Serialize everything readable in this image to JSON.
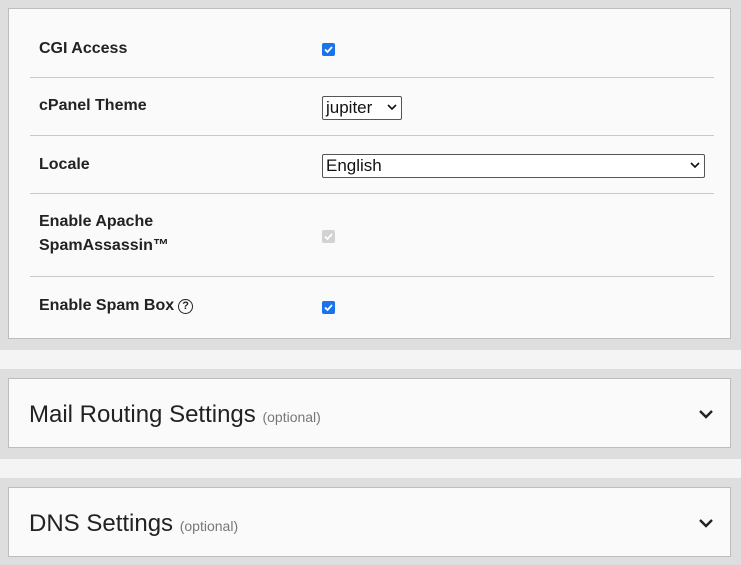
{
  "settings": {
    "cgi_access": {
      "label": "CGI Access",
      "checked": true
    },
    "cpanel_theme": {
      "label": "cPanel Theme",
      "value": "jupiter"
    },
    "locale": {
      "label": "Locale",
      "value": "English"
    },
    "spamassassin": {
      "label_line1": "Enable Apache",
      "label_line2": "SpamAssassin™",
      "checked": true,
      "disabled": true
    },
    "spam_box": {
      "label": "Enable Spam Box",
      "help_icon": "question-circle-icon",
      "checked": true
    }
  },
  "sections": [
    {
      "title": "Mail Routing Settings",
      "optional": "(optional)",
      "icon": "chevron-down-icon"
    },
    {
      "title": "DNS Settings",
      "optional": "(optional)",
      "icon": "chevron-down-icon"
    }
  ],
  "colors": {
    "checkbox": "#1a73e8",
    "border": "#bdbdbd",
    "band": "#dedede"
  }
}
